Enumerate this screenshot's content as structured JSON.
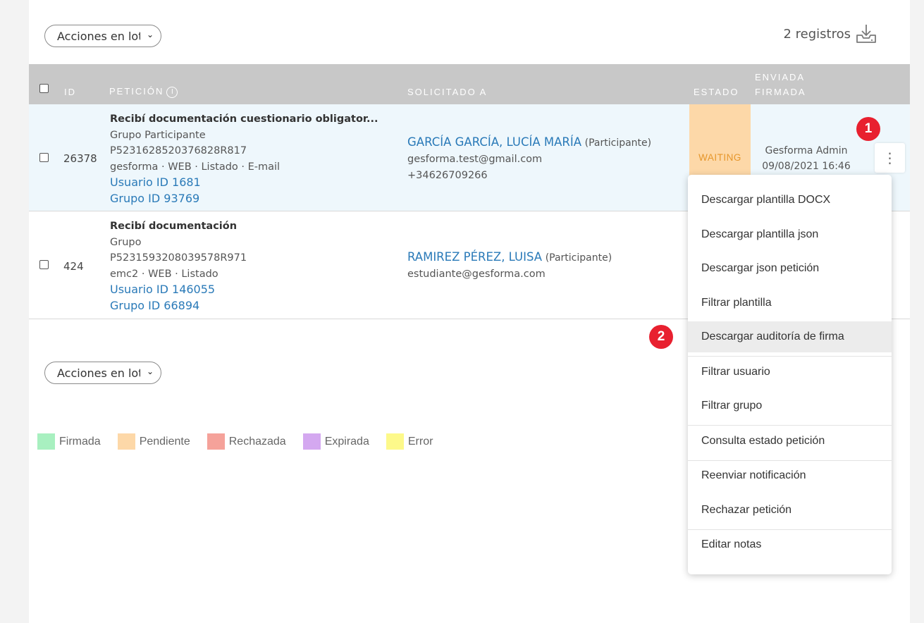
{
  "toolbar": {
    "bulk_actions": "Acciones en lote",
    "records_count": "2 registros"
  },
  "table": {
    "headers": {
      "id": "ID",
      "peticion": "PETICIÓN",
      "solicitado": "SOLICITADO A",
      "estado": "ESTADO",
      "enviada_line1": "ENVIADA",
      "enviada_line2": "FIRMADA"
    },
    "rows": [
      {
        "id": "26378",
        "title": "Recibí documentación cuestionario obligator...",
        "group": "Grupo Participante",
        "code": "P5231628520376828R817",
        "meta": "gesforma · WEB · Listado · E-mail",
        "user_link": "Usuario ID 1681",
        "group_link": "Grupo ID 93769",
        "name": "GARCÍA GARCÍA, LUCÍA MARÍA",
        "role": "(Participante)",
        "email": "gesforma.test@gmail.com",
        "phone": "+34626709266",
        "status": "WAITING",
        "sender": "Gesforma Admin",
        "date": "09/08/2021 16:46"
      },
      {
        "id": "424",
        "title": "Recibí documentación",
        "group": "Grupo",
        "code": "P5231593208039578R971",
        "meta": "emc2 · WEB · Listado",
        "user_link": "Usuario ID 146055",
        "group_link": "Grupo ID 66894",
        "name": "RAMIREZ PÉREZ, LUISA",
        "role": "(Participante)",
        "email": "estudiante@gesforma.com"
      }
    ]
  },
  "badges": {
    "one": "1",
    "two": "2"
  },
  "menu": {
    "items": [
      "Descargar plantilla DOCX",
      "Descargar plantilla json",
      "Descargar json petición",
      "Filtrar plantilla",
      "Descargar auditoría de firma",
      "Filtrar usuario",
      "Filtrar grupo",
      "Consulta estado petición",
      "Reenviar notificación",
      "Rechazar petición",
      "Editar notas"
    ],
    "active_item": "Descargar auditoría de firma"
  },
  "legend": [
    {
      "label": "Firmada",
      "color": "#a8f0c0"
    },
    {
      "label": "Pendiente",
      "color": "#fdd8a8"
    },
    {
      "label": "Rechazada",
      "color": "#f5a29a"
    },
    {
      "label": "Expirada",
      "color": "#d4a8f0"
    },
    {
      "label": "Error",
      "color": "#fdf98a"
    }
  ],
  "colors": {
    "link": "#2a7ab8",
    "status_waiting_bg": "#fdd8a8",
    "status_waiting_text": "#e6962a",
    "badge": "#e8202f",
    "header_bg": "#c8c8c8",
    "selected_row_bg": "#eef7fc"
  }
}
